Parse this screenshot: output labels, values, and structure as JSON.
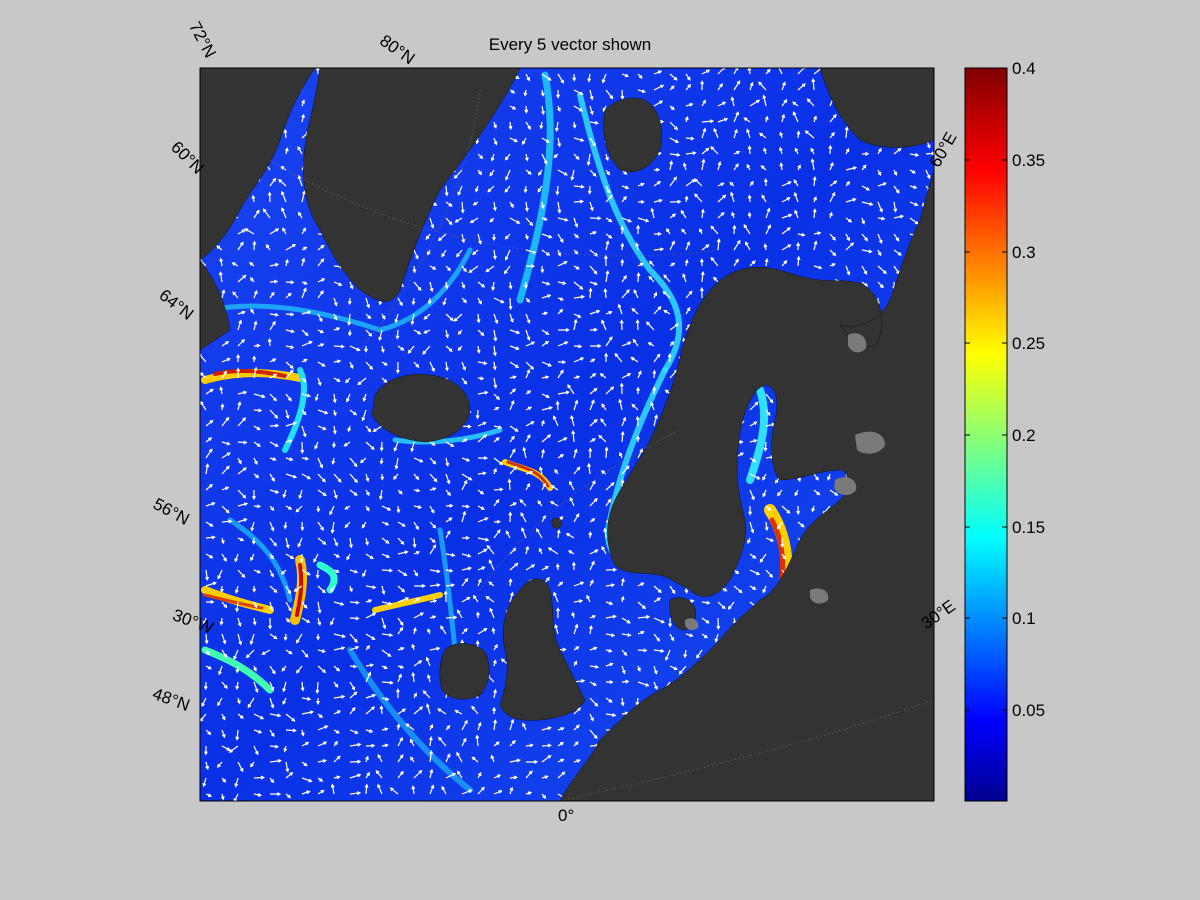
{
  "figure": {
    "title": "Every 5 vector shown"
  },
  "map": {
    "lat_labels": [
      "72°N",
      "60°N",
      "64°N",
      "56°N",
      "48°N"
    ],
    "lon_labels": [
      "80°N",
      "30°W",
      "0°",
      "30°E",
      "60°E"
    ]
  },
  "colorbar": {
    "ticks": [
      "0.4",
      "0.35",
      "0.3",
      "0.25",
      "0.2",
      "0.15",
      "0.1",
      "0.05"
    ],
    "colormap": "jet",
    "range": [
      0,
      0.4
    ]
  },
  "colors": {
    "figure_background": "#c8c8c8",
    "land": "#333333",
    "ocean_low": "#0022dd",
    "ocean_high": "#00e0ff",
    "vector": "#ffffff"
  }
}
